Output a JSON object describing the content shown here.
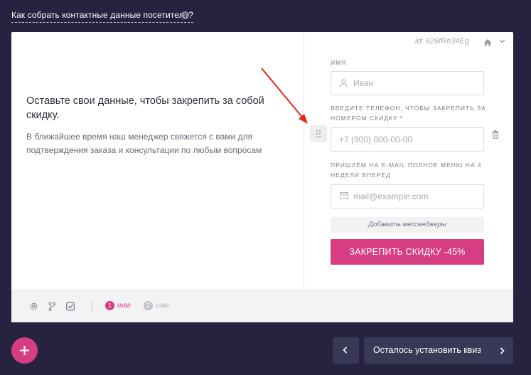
{
  "header": {
    "help_link": "Как собрать контактные данные посетителя?"
  },
  "form": {
    "headline": "Оставьте свои данные, чтобы закрепить за собой скидку.",
    "subtext": "В ближайшее время наш менеджер свяжется с вами для подтверждения заказа и консультации по любым вопросам",
    "id_label": "id: 626fRe34Eg",
    "name_label": "Имя",
    "name_placeholder": "Иван",
    "phone_label": "Введите телефон, чтобы закрепить за номером скидку *",
    "phone_placeholder": "+7 (900) 000-00-00",
    "email_label": "Пришлём на e-mail полное меню на 4 недели вперёд",
    "email_placeholder": "mail@example.com",
    "add_messengers": "Добавить мессенджеры",
    "cta_label": "ЗАКРЕПИТЬ СКИДКУ -45%"
  },
  "footer": {
    "steps": [
      {
        "num": "1",
        "label": "шаг"
      },
      {
        "num": "2",
        "label": "шаг"
      }
    ]
  },
  "bottom": {
    "next_label": "Осталось установить квиз"
  },
  "colors": {
    "background": "#25233f",
    "accent": "#d63d83",
    "button_dark": "#3a3857",
    "annotation_arrow": "#e8241c"
  },
  "icons": [
    "info-icon",
    "drag-handle-icon",
    "home-icon",
    "chevron-down-icon",
    "user-icon",
    "trash-icon",
    "mail-icon",
    "gear-icon",
    "branch-icon",
    "checklist-icon",
    "plus-icon",
    "chevron-left-icon",
    "chevron-right-icon"
  ]
}
